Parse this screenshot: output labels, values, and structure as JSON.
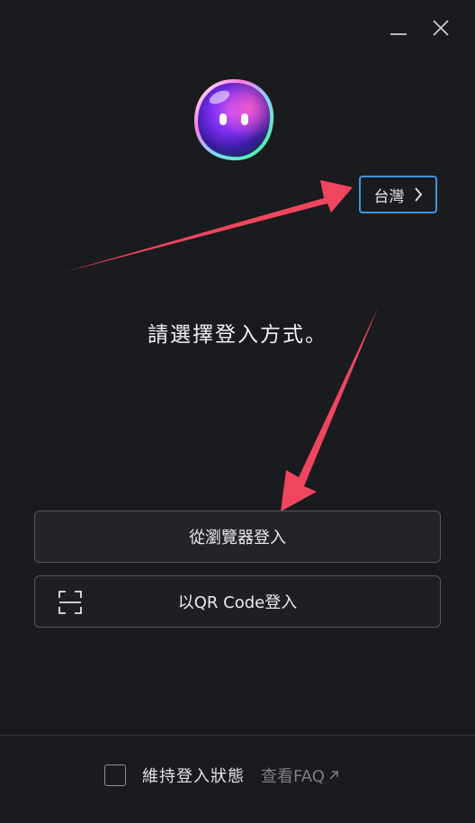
{
  "window": {
    "minimize_icon": "minimize-icon",
    "close_icon": "close-icon"
  },
  "logo": {
    "icon": "bubble-mascot-logo"
  },
  "region": {
    "label": "台灣",
    "icon": "chevron-right-icon",
    "border_color": "#3a97e8"
  },
  "prompt": {
    "text": "請選擇登入方式。"
  },
  "login": {
    "browser_label": "從瀏覽器登入",
    "qr_label": "以QR Code登入",
    "qr_icon": "qr-scan-icon"
  },
  "footer": {
    "keep_login_label": "維持登入狀態",
    "keep_login_checked": false,
    "faq_label": "查看FAQ",
    "faq_icon": "external-link-arrow-icon"
  },
  "annotations": {
    "arrow_color": "#f0455e"
  }
}
